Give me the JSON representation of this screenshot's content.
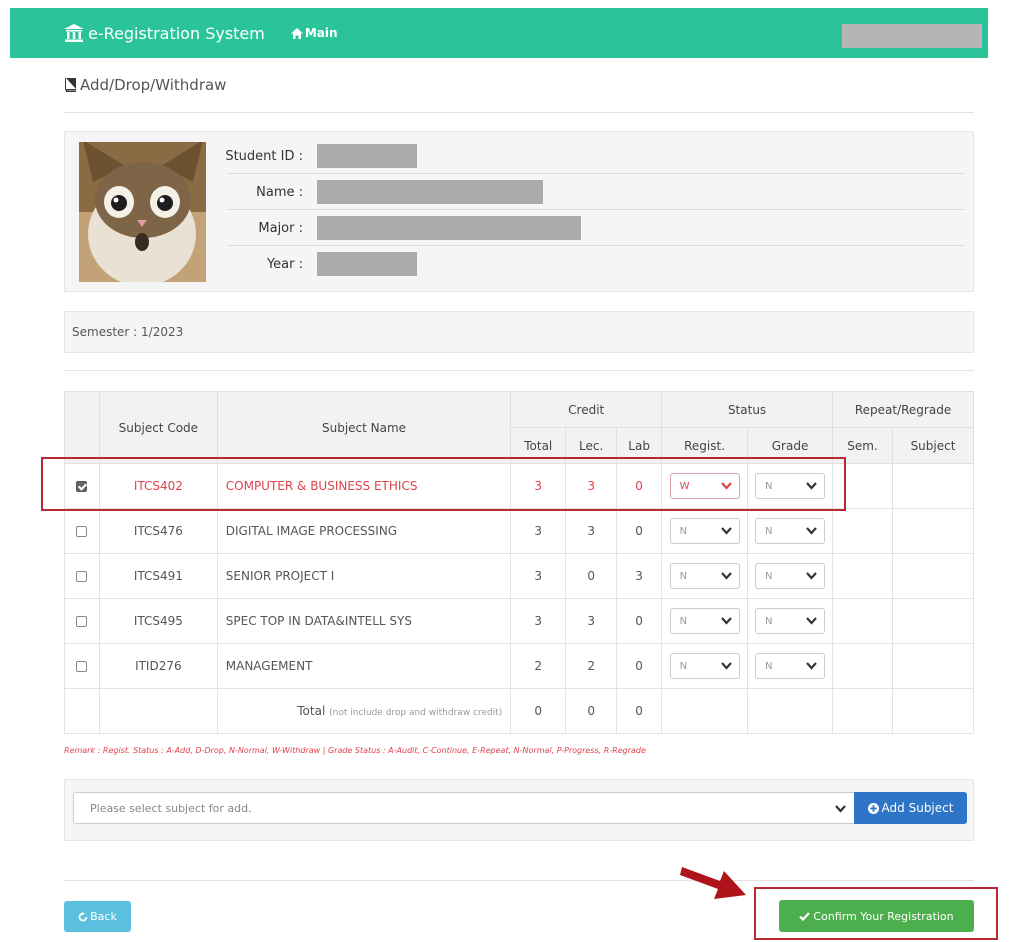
{
  "nav": {
    "brand": "e-Registration System",
    "main_link": "Main"
  },
  "page": {
    "title": "Add/Drop/Withdraw"
  },
  "student": {
    "labels": [
      "Student ID :",
      "Name :",
      "Major :",
      "Year :"
    ]
  },
  "semester": {
    "text": "Semester : 1/2023"
  },
  "table": {
    "headers": {
      "subject_code": "Subject Code",
      "subject_name": "Subject Name",
      "credit": "Credit",
      "status": "Status",
      "repeat_regrade": "Repeat/Regrade",
      "total": "Total",
      "lec": "Lec.",
      "lab": "Lab",
      "regist": "Regist.",
      "grade": "Grade",
      "sem": "Sem.",
      "subject": "Subject"
    },
    "rows": [
      {
        "code": "ITCS402",
        "name": "COMPUTER & BUSINESS ETHICS",
        "total": "3",
        "lec": "3",
        "lab": "0",
        "regist": "W",
        "grade": "N"
      },
      {
        "code": "ITCS476",
        "name": "DIGITAL IMAGE PROCESSING",
        "total": "3",
        "lec": "3",
        "lab": "0",
        "regist": "N",
        "grade": "N"
      },
      {
        "code": "ITCS491",
        "name": "SENIOR PROJECT I",
        "total": "3",
        "lec": "0",
        "lab": "3",
        "regist": "N",
        "grade": "N"
      },
      {
        "code": "ITCS495",
        "name": "SPEC TOP IN DATA&INTELL SYS",
        "total": "3",
        "lec": "3",
        "lab": "0",
        "regist": "N",
        "grade": "N"
      },
      {
        "code": "ITID276",
        "name": "MANAGEMENT",
        "total": "2",
        "lec": "2",
        "lab": "0",
        "regist": "N",
        "grade": "N"
      }
    ],
    "footer": {
      "label": "Total",
      "note": "(not include drop and withdraw credit)",
      "total": "0",
      "lec": "0",
      "lab": "0"
    }
  },
  "remark": "Remark : Regist. Status : A-Add, D-Drop, N-Normal, W-Withdraw | Grade Status : A-Audit, C-Continue, E-Repeat, N-Normal, P-Progress, R-Regrade",
  "add": {
    "placeholder": "Please select subject for add.",
    "button": "Add Subject"
  },
  "actions": {
    "back": "Back",
    "confirm": "Confirm Your Registration"
  },
  "colors": {
    "navbar": "#2bc49a",
    "highlight": "#e0424b",
    "add_button": "#2f75c7",
    "back_button": "#5bc0de",
    "confirm_button": "#4cae4c",
    "annotation": "#b8282e"
  },
  "icons": [
    "university-icon",
    "home-icon",
    "book-icon",
    "chevron-down-icon",
    "plus-circle-icon",
    "refresh-icon",
    "check-icon",
    "arrow-annotation-icon"
  ]
}
